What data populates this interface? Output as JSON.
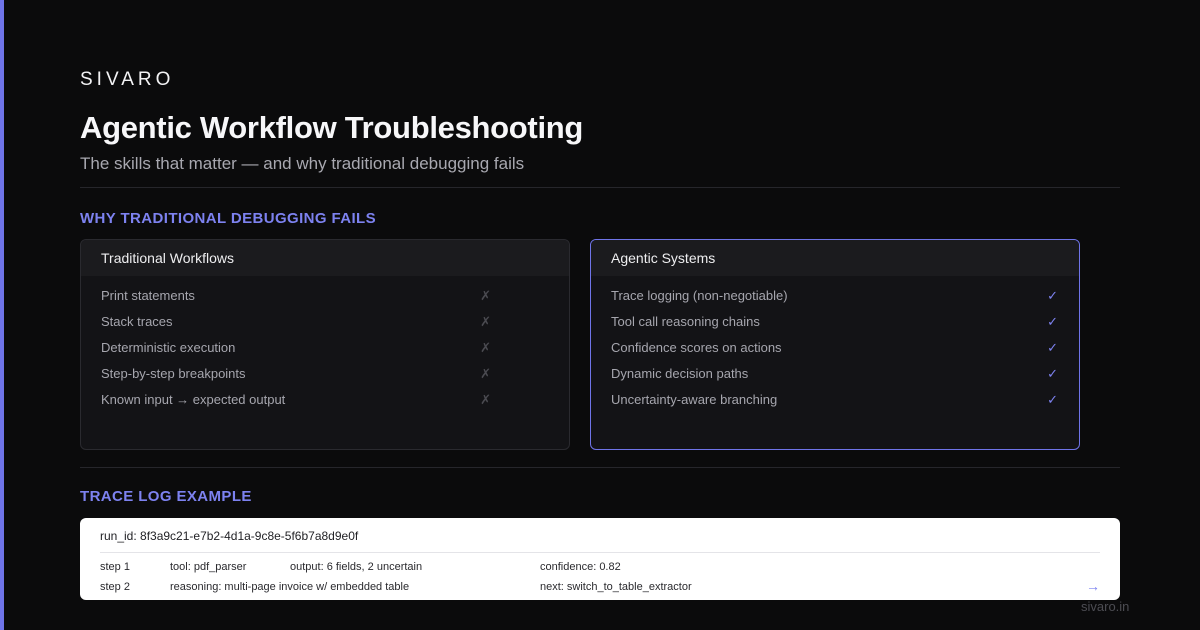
{
  "brand": "SIVARO",
  "title": "Agentic Workflow Troubleshooting",
  "subtitle": "The skills that matter — and why traditional debugging fails",
  "section_why": "WHY TRADITIONAL DEBUGGING FAILS",
  "traditional": {
    "title": "Traditional Workflows",
    "mark": "✗",
    "items": [
      {
        "label": "Print statements"
      },
      {
        "label": "Stack traces"
      },
      {
        "label": "Deterministic execution"
      },
      {
        "label": "Step-by-step breakpoints"
      },
      {
        "label": "Known input → expected output"
      }
    ]
  },
  "agentic": {
    "title": "Agentic Systems",
    "mark": "✓",
    "items": [
      {
        "label": "Trace logging (non-negotiable)"
      },
      {
        "label": "Tool call reasoning chains"
      },
      {
        "label": "Confidence scores on actions"
      },
      {
        "label": "Dynamic decision paths"
      },
      {
        "label": "Uncertainty-aware branching"
      }
    ]
  },
  "section_trace": "TRACE LOG EXAMPLE",
  "trace": {
    "run_id": "run_id: 8f3a9c21-e7b2-4d1a-9c8e-5f6b7a8d9e0f",
    "rows": [
      {
        "step": "step 1",
        "col2": "tool: pdf_parser",
        "col3": "output: 6 fields, 2 uncertain",
        "col4": "confidence: 0.82"
      },
      {
        "step": "step 2",
        "col2": "reasoning: multi-page invoice w/ embedded table",
        "col3": "",
        "col4": "next: switch_to_table_extractor"
      }
    ],
    "arrow": "→"
  },
  "footer": "sivaro.in",
  "colors": {
    "background": "#0b0b0c",
    "accent": "#6f74e8",
    "heading_accent": "#7d82f0",
    "card_bg": "#131316",
    "trace_bg": "#ffffff"
  }
}
